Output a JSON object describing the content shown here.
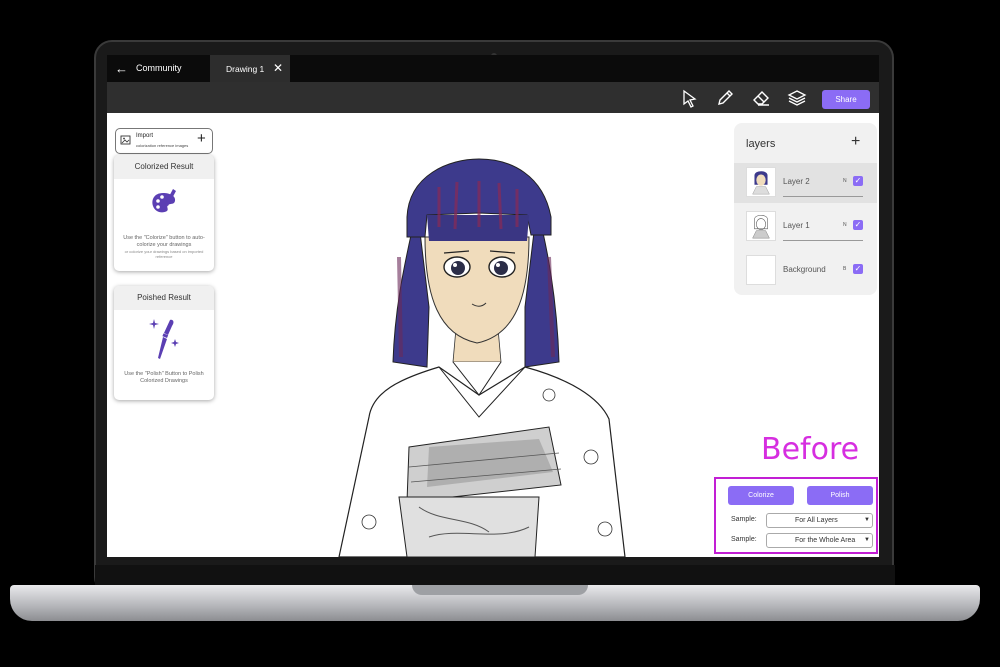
{
  "tabs": {
    "back_label": "Community",
    "active_tab": "Drawing 1"
  },
  "toolbar": {
    "share_label": "Share",
    "tools": [
      "select-arrow-icon",
      "pencil-icon",
      "eraser-icon",
      "layers-icon"
    ]
  },
  "left_panel": {
    "import_title": "Import",
    "import_subtitle": "colorization reference images",
    "colorized": {
      "title": "Colorized Result",
      "text": "Use the \"Colorize\" button to auto-colorize your drawings",
      "small": "or colorize your drawings based on imported reference"
    },
    "polished": {
      "title": "Poished Result",
      "text": "Use the \"Polish\" Button to Polish Colorized Drawings"
    }
  },
  "layers": {
    "title": "layers",
    "items": [
      {
        "name": "Layer 2",
        "mode": "N",
        "checked": true,
        "active": true
      },
      {
        "name": "Layer 1",
        "mode": "N",
        "checked": true,
        "active": false
      },
      {
        "name": "Background",
        "mode": "B",
        "checked": true,
        "active": false
      }
    ]
  },
  "controls": {
    "overlay_label": "Before",
    "colorize_label": "Colorize",
    "polish_label": "Polish",
    "sample_label_1": "Sample:",
    "sample_value_1": "For All Layers",
    "sample_label_2": "Sample:",
    "sample_value_2": "For the Whole Area"
  },
  "colors": {
    "accent": "#8b6cf5",
    "highlight_border": "#c21ed4",
    "overlay_text": "#d62ee0",
    "hair": "#3d3a8c",
    "skin": "#f0dcbc"
  }
}
